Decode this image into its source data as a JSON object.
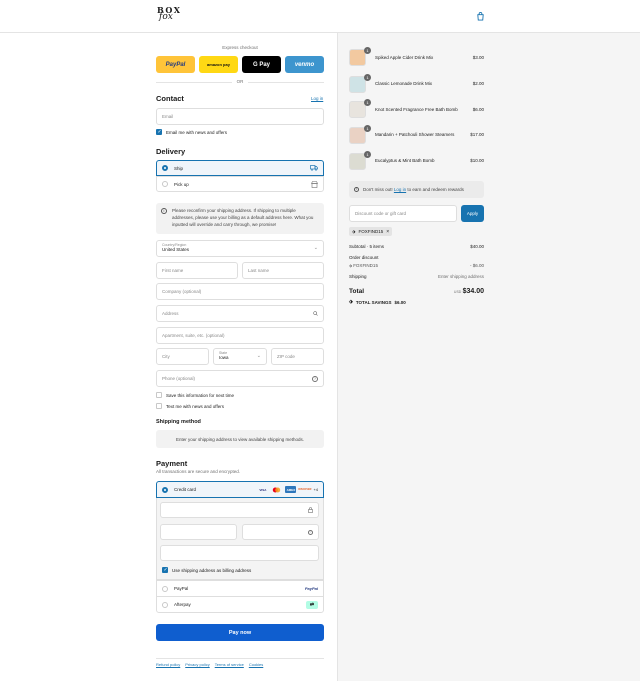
{
  "header": {
    "logo_line1": "BOX",
    "logo_line2": "fox",
    "bag_icon": "shopping-bag-icon"
  },
  "express": {
    "label": "Express checkout",
    "buttons": [
      {
        "label": "PayPal",
        "bg": "#ffc439",
        "fg": "#253b80"
      },
      {
        "label": "amazon pay",
        "bg": "#ffd814",
        "fg": "#111111"
      },
      {
        "label": "G Pay",
        "bg": "#000000",
        "fg": "#ffffff"
      },
      {
        "label": "venmo",
        "bg": "#3d95ce",
        "fg": "#ffffff"
      }
    ],
    "or": "OR"
  },
  "contact": {
    "heading": "Contact",
    "login_link": "Log in",
    "email_placeholder": "Email",
    "news_checkbox": "Email me with news and offers"
  },
  "delivery": {
    "heading": "Delivery",
    "options": [
      {
        "label": "Ship",
        "icon": "truck-icon"
      },
      {
        "label": "Pick up",
        "icon": "store-icon"
      }
    ],
    "notice": "Please reconfirm your shipping address. If shipping to multiple addresses, please use your billing as a default address here. What you inputted will override and carry through, we promise!",
    "country_label": "Country/Region",
    "country_value": "United States",
    "first_name": "First name",
    "last_name": "Last name",
    "company": "Company (optional)",
    "address": "Address",
    "apartment": "Apartment, suite, etc. (optional)",
    "city": "City",
    "state_label": "State",
    "state_value": "Iowa",
    "zip": "ZIP code",
    "phone": "Phone (optional)",
    "save_info": "Save this information for next time",
    "text_me": "Text me with news and offers"
  },
  "shipping_method": {
    "heading": "Shipping method",
    "message": "Enter your shipping address to view available shipping methods."
  },
  "payment": {
    "heading": "Payment",
    "subtext": "All transactions are secure and encrypted.",
    "credit_card": "Credit card",
    "card_icons": [
      "VISA",
      "MC",
      "AMEX",
      "DISCOVER",
      "+4"
    ],
    "billing_checkbox": "Use shipping address as billing address",
    "paypal": "PayPal",
    "paypal_logo": "PayPal",
    "afterpay": "Afterpay",
    "pay_now": "Pay now"
  },
  "footer": {
    "links": [
      "Refund policy",
      "Privacy policy",
      "Terms of service",
      "Cookies"
    ]
  },
  "cart": {
    "items": [
      {
        "name": "Spiked Apple Cider Drink Mix",
        "qty": "1",
        "price": "$3.00",
        "color": "#f2c9a0"
      },
      {
        "name": "Classic Lemonade Drink Mix",
        "qty": "1",
        "price": "$2.00",
        "color": "#cfe3e6"
      },
      {
        "name": "Knot Scented Fragrance Free Bath Bomb",
        "qty": "1",
        "price": "$6.00",
        "color": "#e8e4de"
      },
      {
        "name": "Mandarin + Patchouli Shower Steamers",
        "qty": "1",
        "price": "$17.00",
        "color": "#ead2c4"
      },
      {
        "name": "Eucalyptus & Mint Bath Bomb",
        "qty": "1",
        "price": "$10.00",
        "color": "#dcdcd2"
      }
    ],
    "rewards_prefix": "Don't miss out! ",
    "rewards_link": "Log in",
    "rewards_suffix": " to earn and redeem rewards",
    "discount_placeholder": "Discount code or gift card",
    "apply": "Apply",
    "code_tag": "FOXFIND15",
    "subtotal_label": "Subtotal · 5 items",
    "subtotal_value": "$40.00",
    "order_discount_label": "Order discount",
    "discount_code": "FOXFIND15",
    "discount_value": "- $6.00",
    "shipping_label": "Shipping",
    "shipping_value": "Enter shipping address",
    "total_label": "Total",
    "total_currency": "USD",
    "total_value": "$34.00",
    "savings_label": "TOTAL SAVINGS",
    "savings_value": "$6.00"
  }
}
